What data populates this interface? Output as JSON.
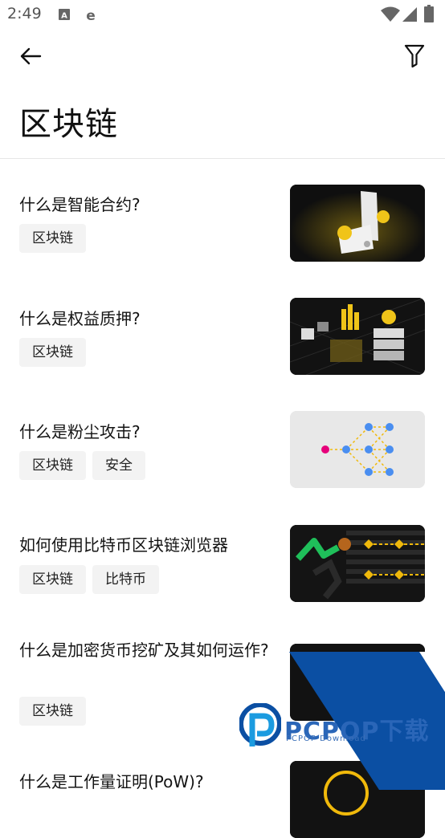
{
  "status_bar": {
    "time": "2:49",
    "icons": [
      "keyboard-a-icon",
      "browser-e-icon",
      "wifi-icon",
      "signal-icon",
      "battery-icon"
    ]
  },
  "header": {
    "title": "区块链",
    "back_icon": "arrow-left-icon",
    "filter_icon": "filter-icon"
  },
  "articles": [
    {
      "title": "什么是智能合约?",
      "tags": [
        "区块链"
      ],
      "thumb": "smart-contract"
    },
    {
      "title": "什么是权益质押?",
      "tags": [
        "区块链"
      ],
      "thumb": "staking"
    },
    {
      "title": "什么是粉尘攻击?",
      "tags": [
        "区块链",
        "安全"
      ],
      "thumb": "dust-attack"
    },
    {
      "title": "如何使用比特币区块链浏览器",
      "tags": [
        "区块链",
        "比特币"
      ],
      "thumb": "explorer"
    },
    {
      "title": "什么是加密货币挖矿及其如何运作?",
      "tags": [
        "区块链"
      ],
      "thumb": "mining"
    },
    {
      "title": "什么是工作量证明(PoW)?",
      "tags": [],
      "thumb": "pow"
    }
  ],
  "watermark": {
    "brand": "PCPOP下载",
    "subtitle": "PCPOP Download",
    "colors": {
      "blue": "#0b4fa3",
      "black": "#111111"
    }
  }
}
